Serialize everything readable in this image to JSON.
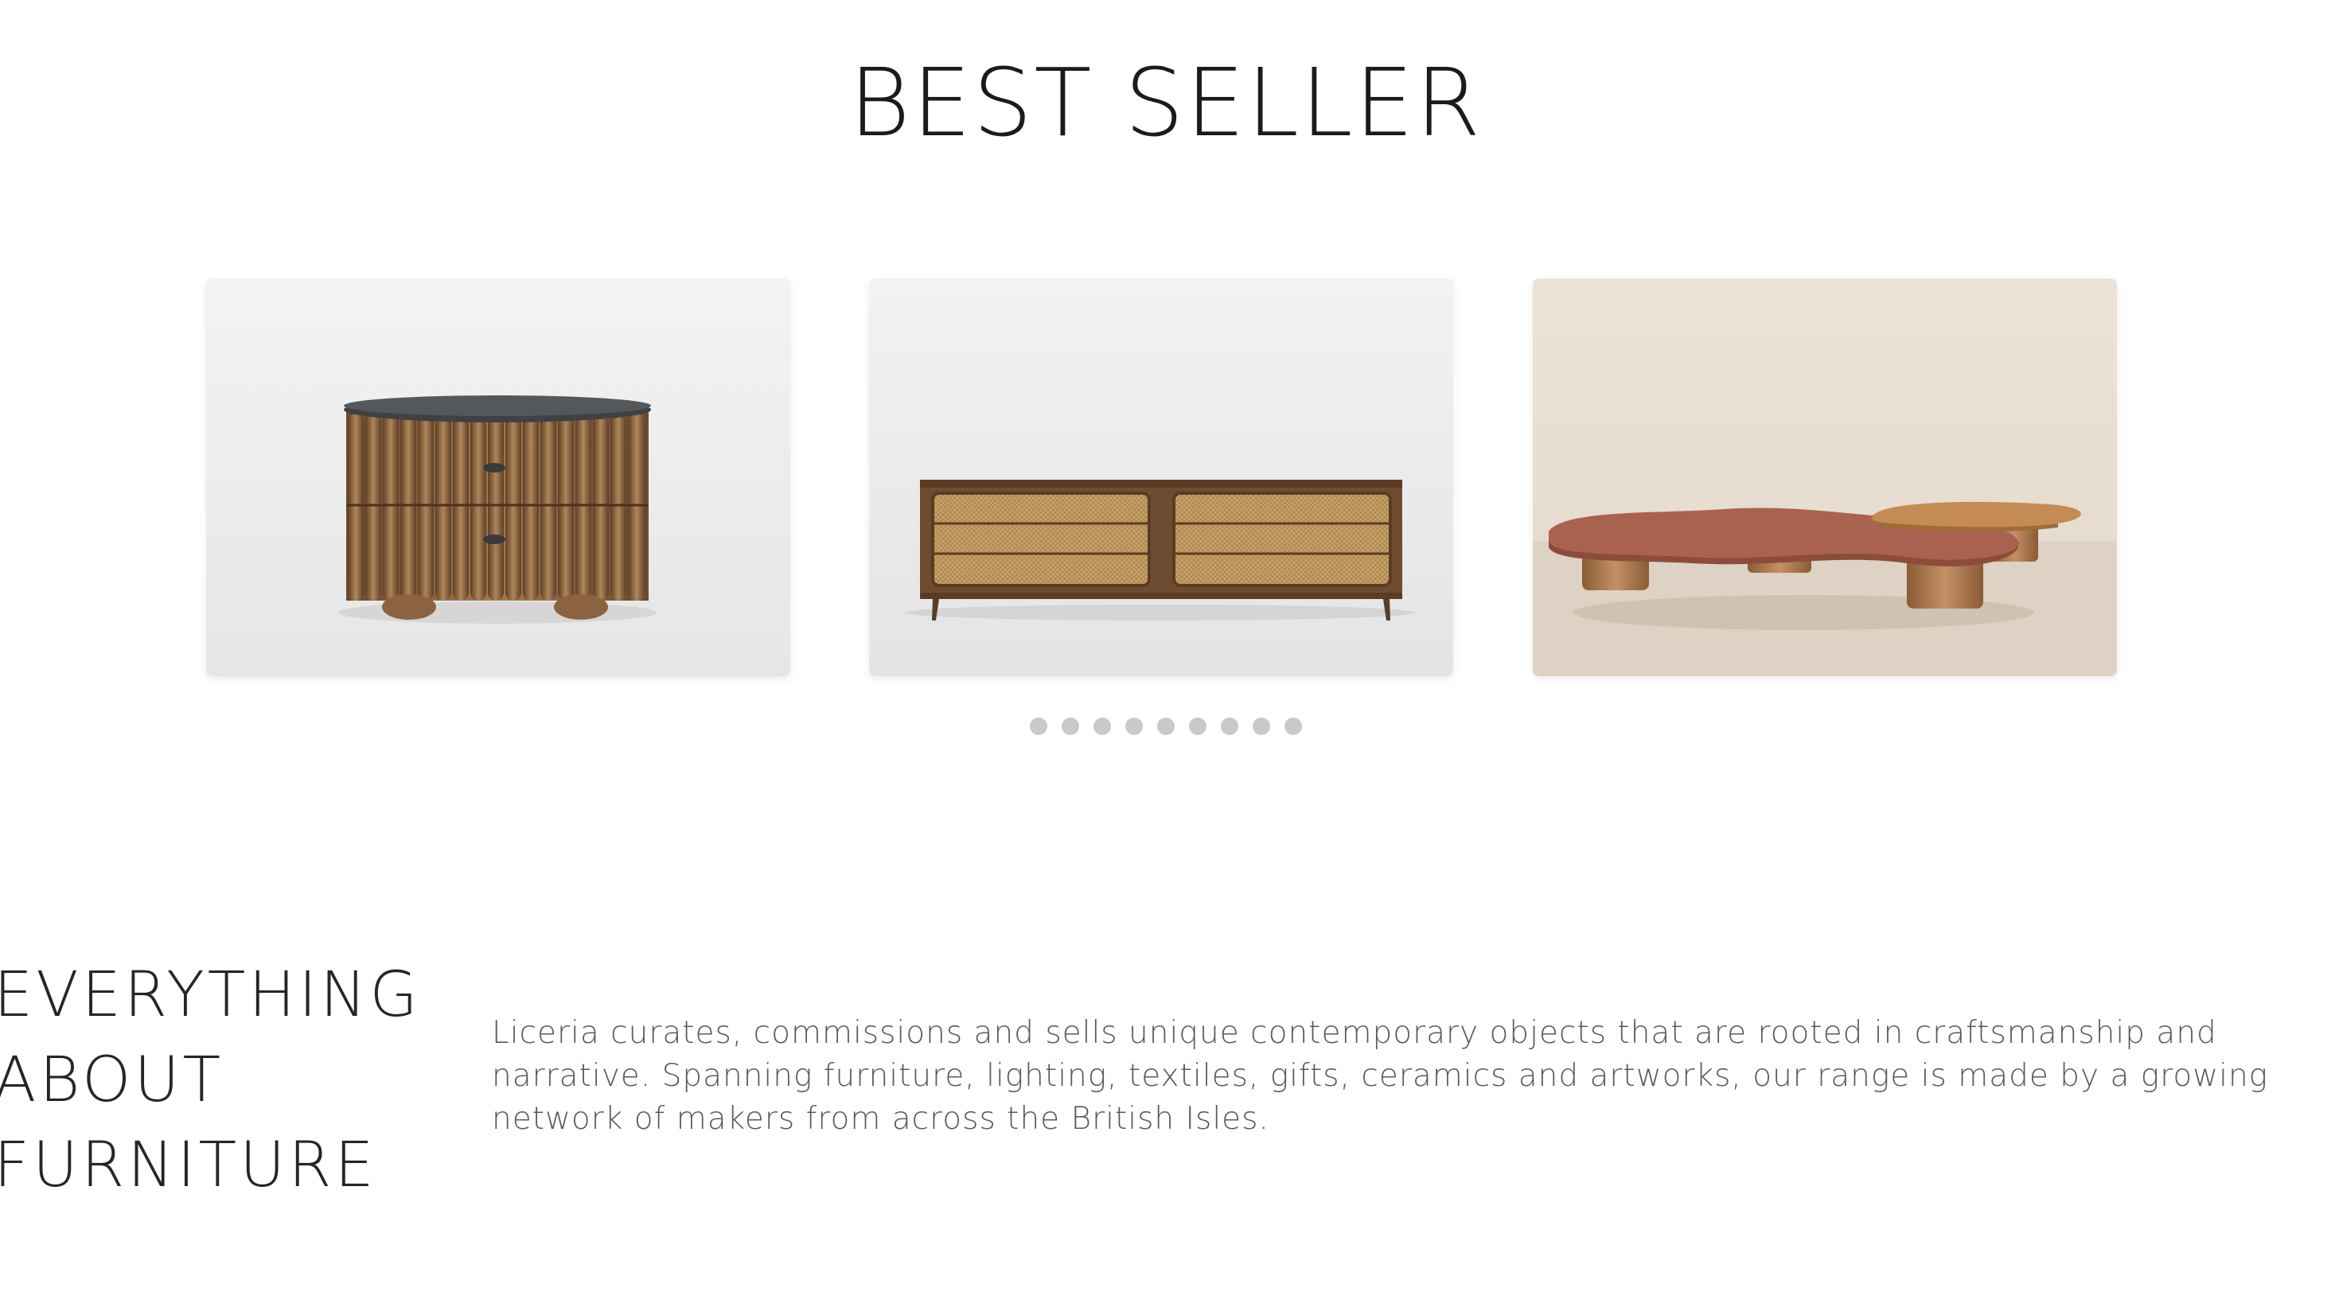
{
  "section_title": "BEST SELLER",
  "products": [
    {
      "name": "fluted-nightstand"
    },
    {
      "name": "rattan-sideboard"
    },
    {
      "name": "marble-coffee-table"
    }
  ],
  "carousel": {
    "dot_count": 9
  },
  "about": {
    "heading_lines": [
      "EVERYTHING",
      "ABOUT",
      "FURNITURE"
    ],
    "text": "Liceria curates, commissions and sells unique contemporary objects that are rooted in craftsmanship and narrative. Spanning furniture, lighting, textiles, gifts, ceramics and artworks, our range is made by a growing network of makers from across the British Isles."
  }
}
